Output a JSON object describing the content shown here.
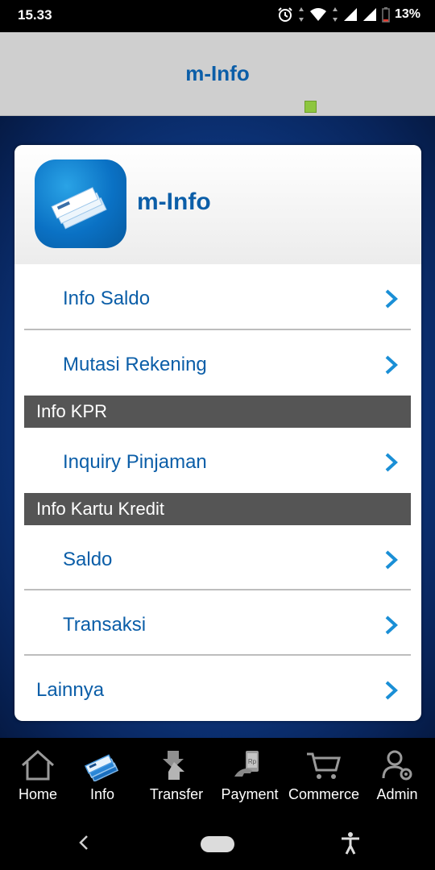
{
  "status_bar": {
    "time": "15.33",
    "battery": "13%"
  },
  "header": {
    "title": "m-Info",
    "status_color": "#8dc63f"
  },
  "card": {
    "title": "m-Info",
    "items": [
      {
        "label": "Info Saldo"
      },
      {
        "label": "Mutasi Rekening"
      }
    ],
    "section_kpr": "Info KPR",
    "kpr_items": [
      {
        "label": "Inquiry Pinjaman"
      }
    ],
    "section_kartu": "Info Kartu Kredit",
    "kartu_items": [
      {
        "label": "Saldo"
      },
      {
        "label": "Transaksi"
      }
    ],
    "other": {
      "label": "Lainnya"
    }
  },
  "bottom_nav": [
    {
      "label": "Home",
      "icon": "home-icon"
    },
    {
      "label": "Info",
      "icon": "info-cards-icon"
    },
    {
      "label": "Transfer",
      "icon": "transfer-icon"
    },
    {
      "label": "Payment",
      "icon": "payment-icon"
    },
    {
      "label": "Commerce",
      "icon": "cart-icon"
    },
    {
      "label": "Admin",
      "icon": "admin-icon"
    }
  ],
  "colors": {
    "accent": "#0b5ea8",
    "section_bg": "#555555",
    "chevron": "#1a8fd6"
  }
}
